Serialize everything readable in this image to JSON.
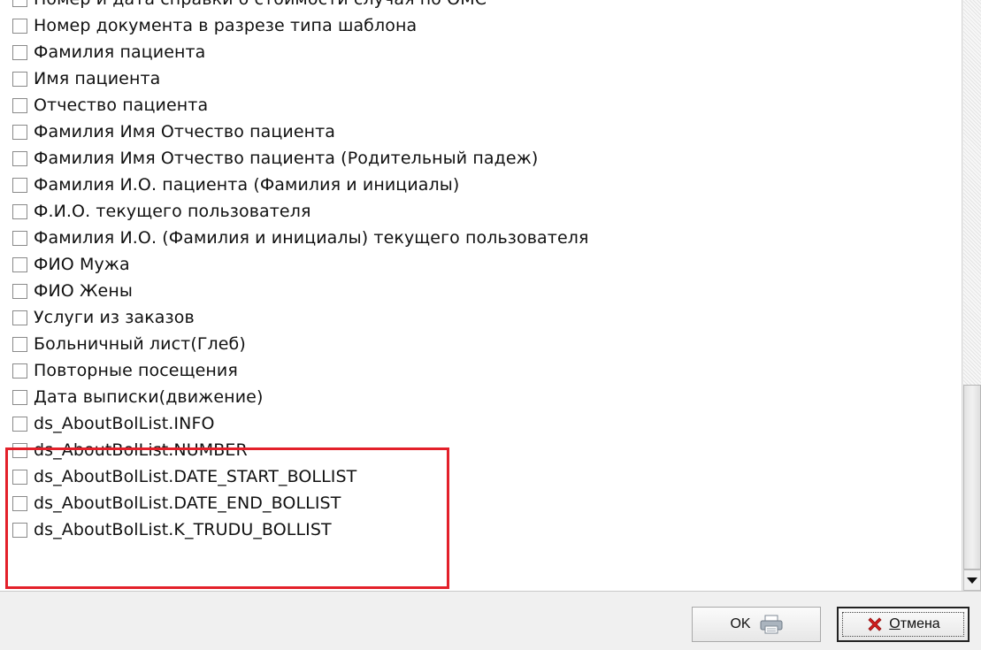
{
  "list": {
    "items": [
      {
        "label": "Номер и дата справки о стоимости случая по ОМС",
        "checked": false
      },
      {
        "label": "Номер документа в разрезе типа шаблона",
        "checked": false
      },
      {
        "label": "Фамилия пациента",
        "checked": false
      },
      {
        "label": "Имя пациента",
        "checked": false
      },
      {
        "label": "Отчество пациента",
        "checked": false
      },
      {
        "label": "Фамилия Имя Отчество пациента",
        "checked": false
      },
      {
        "label": "Фамилия Имя Отчество пациента (Родительный падеж)",
        "checked": false
      },
      {
        "label": "Фамилия И.О. пациента (Фамилия и инициалы)",
        "checked": false
      },
      {
        "label": "Ф.И.О. текущего пользователя",
        "checked": false
      },
      {
        "label": "Фамилия И.О. (Фамилия и инициалы) текущего пользователя",
        "checked": false
      },
      {
        "label": "ФИО Мужа",
        "checked": false
      },
      {
        "label": "ФИО Жены",
        "checked": false
      },
      {
        "label": "Услуги из заказов",
        "checked": false
      },
      {
        "label": "Больничный лист(Глеб)",
        "checked": false
      },
      {
        "label": "Повторные посещения",
        "checked": false
      },
      {
        "label": "Дата выписки(движение)",
        "checked": false
      },
      {
        "label": "ds_AboutBolList.INFO",
        "checked": false
      },
      {
        "label": "ds_AboutBolList.NUMBER",
        "checked": false
      },
      {
        "label": "ds_AboutBolList.DATE_START_BOLLIST",
        "checked": false
      },
      {
        "label": "ds_AboutBolList.DATE_END_BOLLIST",
        "checked": false
      },
      {
        "label": "ds_AboutBolList.K_TRUDU_BOLLIST",
        "checked": false
      }
    ]
  },
  "buttons": {
    "ok_label": "OK",
    "cancel_label": "Отмена"
  },
  "colors": {
    "highlight": "#e3202a",
    "cancel_icon": "#d21f1f"
  },
  "icons": {
    "ok": "printer-icon",
    "cancel": "red-x-icon"
  }
}
